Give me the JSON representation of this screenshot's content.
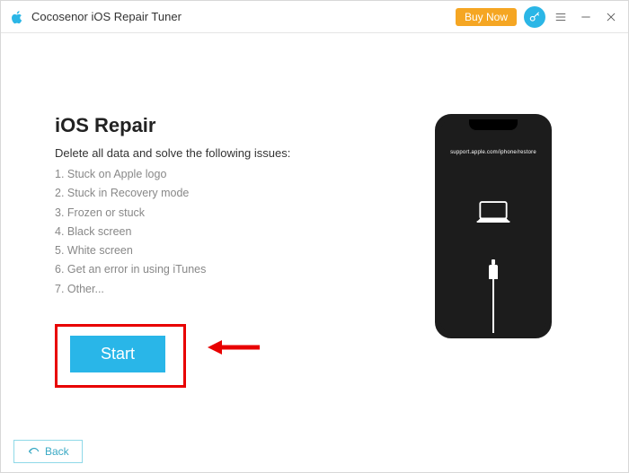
{
  "titlebar": {
    "app_title": "Cocosenor iOS Repair Tuner",
    "buy_now": "Buy Now"
  },
  "main": {
    "heading": "iOS Repair",
    "subheading": "Delete all data and solve the following issues:",
    "issues": [
      "1. Stuck on Apple logo",
      "2. Stuck in Recovery mode",
      "3. Frozen or stuck",
      "4. Black screen",
      "5. White screen",
      "6. Get an error in using iTunes",
      "7. Other..."
    ],
    "start_label": "Start",
    "phone_text": "support.apple.com/iphone/restore"
  },
  "footer": {
    "back_label": "Back"
  },
  "colors": {
    "accent": "#29b6e8",
    "highlight_border": "#e80000",
    "buy_now": "#f5a623"
  }
}
